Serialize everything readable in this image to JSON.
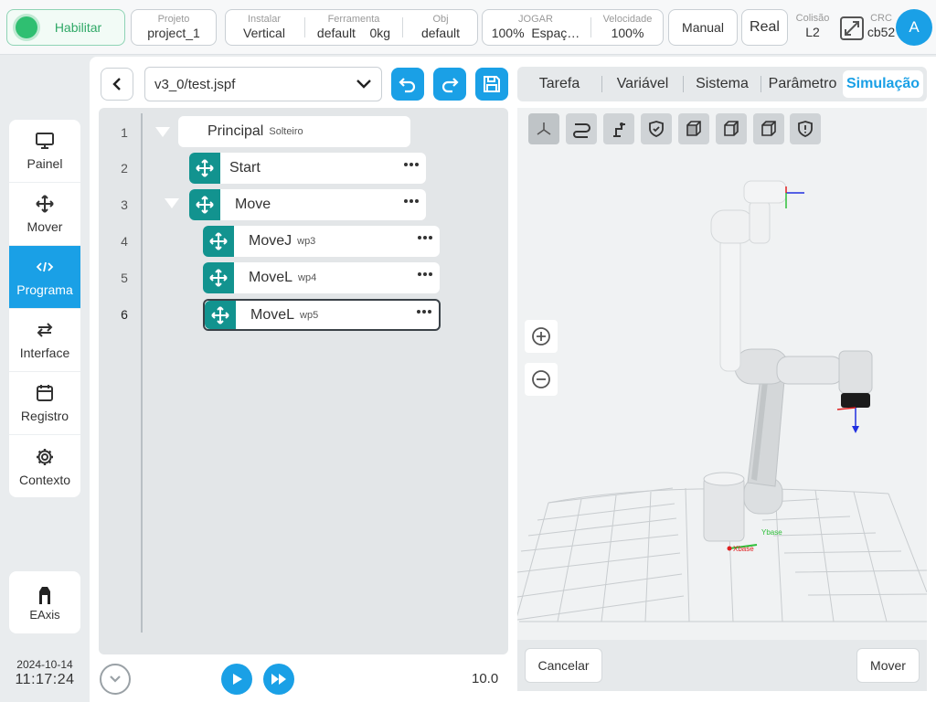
{
  "topbar": {
    "enable_label": "Habilitar",
    "project": {
      "label": "Projeto",
      "value": "project_1"
    },
    "install": {
      "label": "Instalar",
      "value": "Vertical"
    },
    "tool": {
      "label": "Ferramenta",
      "value": "default"
    },
    "tool_weight": "0kg",
    "obj": {
      "label": "Obj",
      "value": "default"
    },
    "jog": {
      "label": "JOGAR",
      "value": "100%",
      "space": "Espaç…"
    },
    "speed": {
      "label": "Velocidade",
      "value": "100%"
    },
    "manual_label": "Manual",
    "real_label": "Real",
    "collision": {
      "label": "Colisão",
      "value": "L2"
    },
    "crc": {
      "label": "CRC",
      "value": "cb52"
    },
    "avatar_letter": "A"
  },
  "nav": {
    "items": [
      {
        "label": "Painel",
        "icon": "monitor-icon"
      },
      {
        "label": "Mover",
        "icon": "move-arrows-icon"
      },
      {
        "label": "Programa",
        "icon": "code-icon",
        "active": true
      },
      {
        "label": "Interface",
        "icon": "swap-icon"
      },
      {
        "label": "Registro",
        "icon": "calendar-icon"
      },
      {
        "label": "Contexto",
        "icon": "gear-icon"
      }
    ],
    "eaxis_label": "EAxis"
  },
  "datetime": {
    "date": "2024-10-14",
    "time": "11:17:24"
  },
  "program": {
    "file": "v3_0/test.jspf",
    "lines": [
      "1",
      "2",
      "3",
      "4",
      "5",
      "6"
    ],
    "nodes": [
      {
        "name": "Principal",
        "sub": "Solteiro"
      },
      {
        "name": "Start",
        "sub": ""
      },
      {
        "name": "Move",
        "sub": ""
      },
      {
        "name": "MoveJ",
        "sub": "wp3"
      },
      {
        "name": "MoveL",
        "sub": "wp4"
      },
      {
        "name": "MoveL",
        "sub": "wp5"
      }
    ],
    "speed_value": "10.0"
  },
  "tabs": [
    {
      "label": "Tarefa"
    },
    {
      "label": "Variável"
    },
    {
      "label": "Sistema"
    },
    {
      "label": "Parâmetro"
    },
    {
      "label": "Simulação",
      "active": true
    }
  ],
  "simulation": {
    "base_axis_x": "Xbase",
    "base_axis_y": "Ybase",
    "cancel_label": "Cancelar",
    "move_label": "Mover"
  },
  "colors": {
    "accent": "#1aa0e6",
    "move_node": "#12938f",
    "enable": "#2fbf71"
  }
}
